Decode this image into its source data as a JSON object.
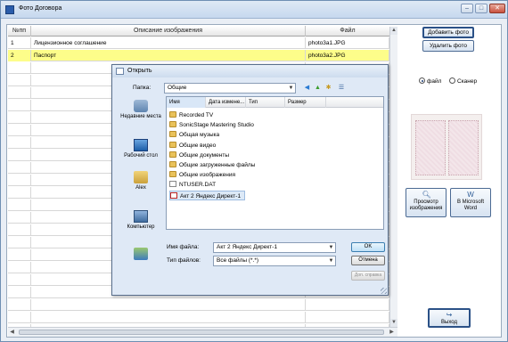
{
  "window": {
    "title": "Фото Договора",
    "min_glyph": "–",
    "max_glyph": "□",
    "close_glyph": "✕"
  },
  "grid": {
    "columns": [
      "№пп",
      "Описание изображения",
      "Файл"
    ],
    "rows": [
      {
        "num": "1",
        "description": "Лицензионное соглашение",
        "file": "photo3a1.JPG",
        "selected": false
      },
      {
        "num": "2",
        "description": "Паспорт",
        "file": "photo3a2.JPG",
        "selected": true
      }
    ]
  },
  "side": {
    "add_photo": "Добавить фото",
    "delete_photo": "Удалить фото",
    "radio_file": "файл",
    "radio_scanner": "Сканер",
    "view_image": "Просмотр изображения",
    "to_word": "В Microsoft Word",
    "exit": "Выход"
  },
  "dialog": {
    "title": "Открыть",
    "folder_label": "Папка:",
    "folder_value": "Общие",
    "places": [
      "Недавние места",
      "Рабочий стол",
      "Alex",
      "Компьютер"
    ],
    "columns": [
      "Имя",
      "Дата измене...",
      "Тип",
      "Размер"
    ],
    "files": [
      {
        "name": "Recorded TV",
        "kind": "folder"
      },
      {
        "name": "SonicStage Mastering Studio",
        "kind": "folder"
      },
      {
        "name": "Общая музыка",
        "kind": "folder"
      },
      {
        "name": "Общие видео",
        "kind": "folder"
      },
      {
        "name": "Общие документы",
        "kind": "folder"
      },
      {
        "name": "Общие загруженные файлы",
        "kind": "folder"
      },
      {
        "name": "Общие изображения",
        "kind": "folder"
      },
      {
        "name": "NTUSER.DAT",
        "kind": "doc"
      },
      {
        "name": "Акт 2 Яндекс Директ-1",
        "kind": "pdf",
        "selected": true
      }
    ],
    "filename_label": "Имя файла:",
    "filename_value": "Акт 2 Яндекс Директ-1",
    "filetype_label": "Тип файлов:",
    "filetype_value": "Все файлы (*.*)",
    "ok": "OK",
    "cancel": "Отмена",
    "help": "Доп. справка"
  }
}
